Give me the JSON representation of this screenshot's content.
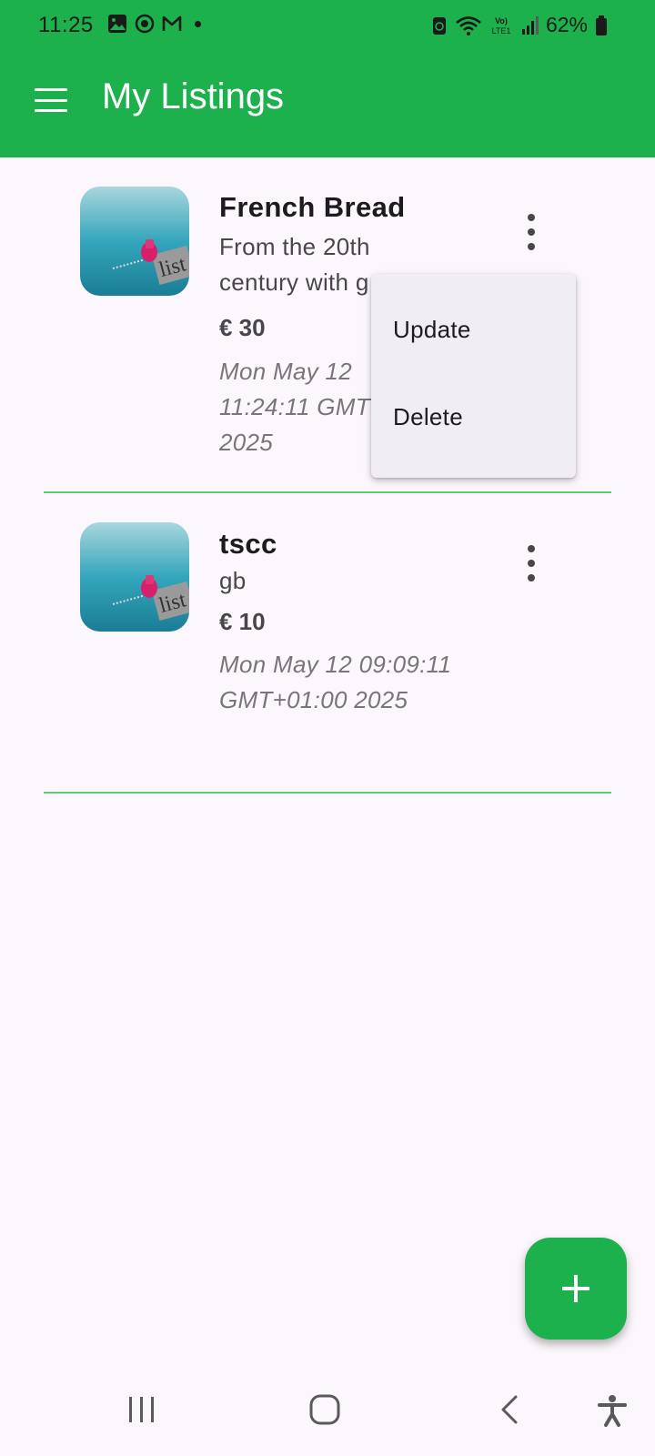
{
  "status_bar": {
    "time": "11:25",
    "battery": "62%",
    "left_icons": [
      "image-icon",
      "record-icon",
      "gmail-icon",
      "dot-icon"
    ],
    "right_icons": [
      "recycle-icon",
      "wifi-icon",
      "volte-icon",
      "signal-icon",
      "battery-icon"
    ]
  },
  "app_bar": {
    "title": "My Listings",
    "color": "#1db14d"
  },
  "listings": [
    {
      "title": "French Bread",
      "description": "From the 20th century with g",
      "price": "€ 30",
      "date": "Mon May 12 11:24:11 GMT 2025"
    },
    {
      "title": "tscc",
      "description": "gb",
      "price": "€ 10",
      "date": "Mon May 12 09:09:11 GMT+01:00 2025"
    }
  ],
  "popup_menu": {
    "items": [
      "Update",
      "Delete"
    ]
  },
  "fab": {
    "icon": "plus-icon"
  },
  "nav_bar": {
    "icons": [
      "recent-apps-icon",
      "home-icon",
      "back-icon",
      "accessibility-icon"
    ]
  }
}
